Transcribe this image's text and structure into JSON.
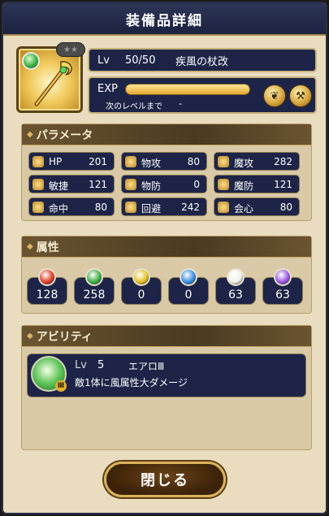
{
  "title": "装備品詳細",
  "item": {
    "icon": "wind-staff-icon",
    "element_badge": "wind-orb-icon",
    "lv_label": "Lv",
    "lv_value": "50/50",
    "name": "疾風の杖改",
    "exp_label": "EXP",
    "exp_fill": 1.0,
    "next_label": "次のレベルまで",
    "next_value": "-"
  },
  "parameters": {
    "header": "パラメータ",
    "stats": [
      {
        "label": "HP",
        "value": "201",
        "icon": "heart-icon"
      },
      {
        "label": "物攻",
        "value": "80",
        "icon": "sword-icon"
      },
      {
        "label": "魔攻",
        "value": "282",
        "icon": "magic-staff-icon"
      },
      {
        "label": "敏捷",
        "value": "121",
        "icon": "wing-icon"
      },
      {
        "label": "物防",
        "value": "0",
        "icon": "shield-icon"
      },
      {
        "label": "魔防",
        "value": "121",
        "icon": "magic-shield-icon"
      },
      {
        "label": "命中",
        "value": "80",
        "icon": "bow-icon"
      },
      {
        "label": "回避",
        "value": "242",
        "icon": "dodge-icon"
      },
      {
        "label": "会心",
        "value": "80",
        "icon": "critical-icon"
      }
    ]
  },
  "attributes": {
    "header": "属性",
    "items": [
      {
        "value": "128",
        "color": "#e0402a",
        "icon": "fire-orb-icon"
      },
      {
        "value": "258",
        "color": "#3fb043",
        "icon": "wind-orb-icon"
      },
      {
        "value": "0",
        "color": "#e7c22a",
        "icon": "thunder-orb-icon"
      },
      {
        "value": "0",
        "color": "#3a8fe0",
        "icon": "water-orb-icon"
      },
      {
        "value": "63",
        "color": "#f2f2e8",
        "icon": "light-orb-icon"
      },
      {
        "value": "63",
        "color": "#9a5ae0",
        "icon": "dark-orb-icon"
      }
    ]
  },
  "ability": {
    "header": "アビリティ",
    "lv_label": "Lv",
    "lv_value": "5",
    "name": "エアロⅢ",
    "badge": "Ⅲ",
    "description": "敵1体に風属性大ダメージ"
  },
  "close_label": "閉じる"
}
